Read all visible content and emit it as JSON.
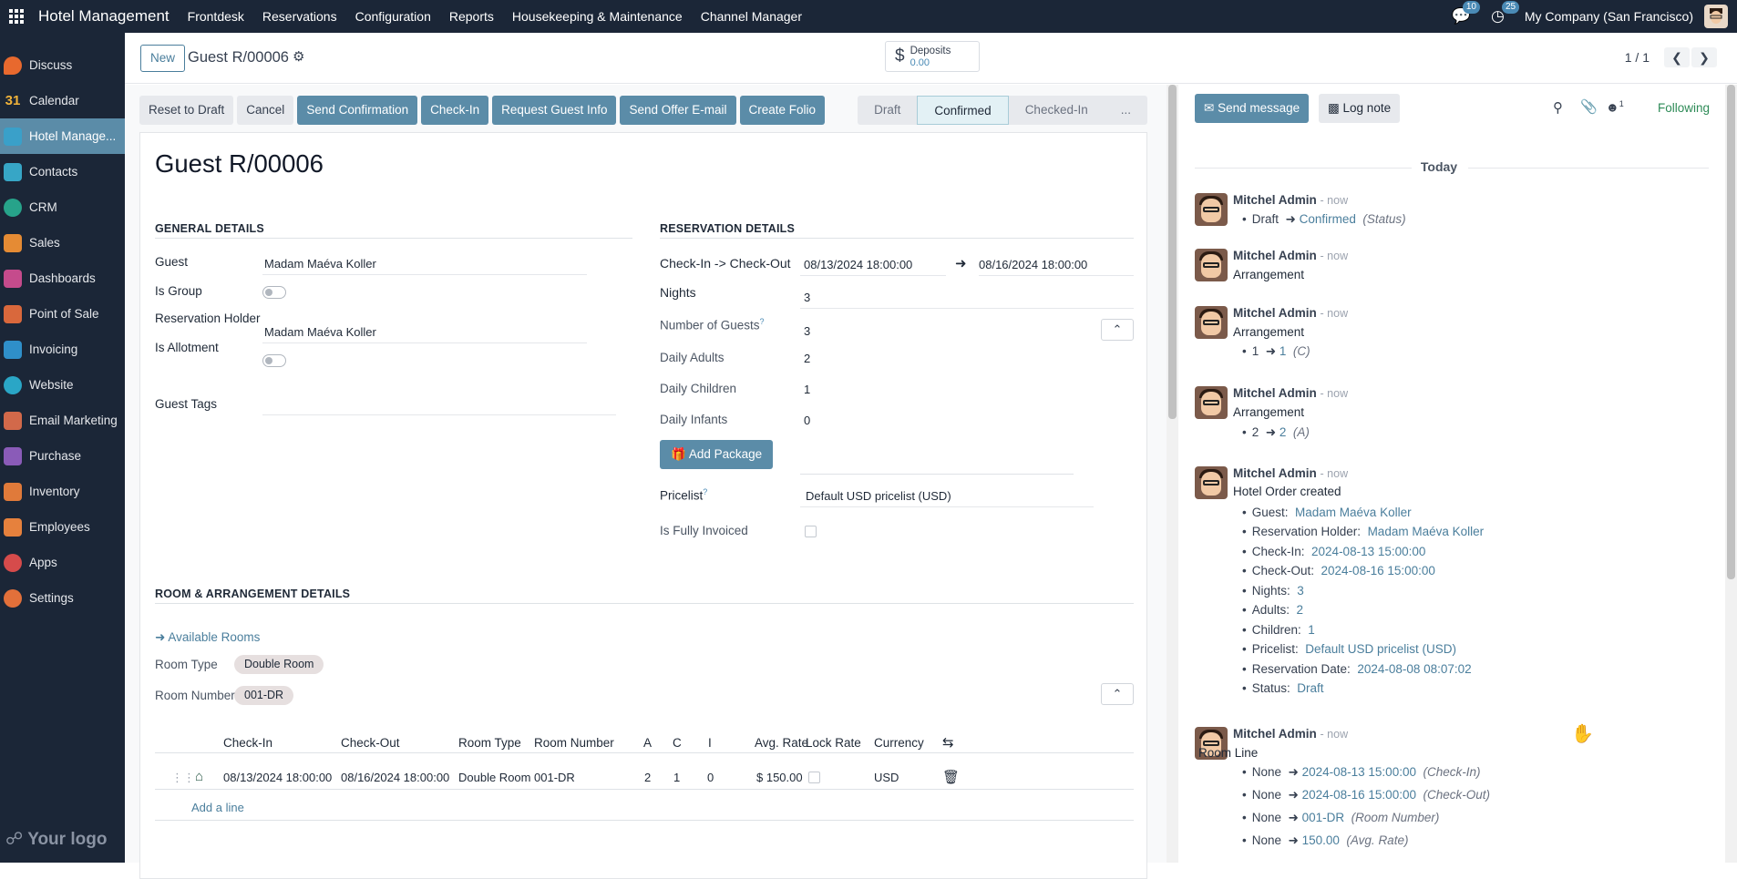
{
  "topbar": {
    "app_name": "Hotel Management",
    "menus": [
      "Frontdesk",
      "Reservations",
      "Configuration",
      "Reports",
      "Housekeeping & Maintenance",
      "Channel Manager"
    ],
    "messages_count": "10",
    "activity_count": "25",
    "company": "My Company (San Francisco)"
  },
  "sidebar": {
    "items": [
      {
        "label": "Discuss",
        "icon": "discuss-icon",
        "color": "#e8692e"
      },
      {
        "label": "Calendar",
        "icon": "calendar-icon",
        "color": "#f1b33a",
        "glyph": "31"
      },
      {
        "label": "Hotel Manage...",
        "icon": "hotel-icon",
        "color": "#3aa0c9",
        "active": true
      },
      {
        "label": "Contacts",
        "icon": "contacts-icon",
        "color": "#37a6c6"
      },
      {
        "label": "CRM",
        "icon": "crm-icon",
        "color": "#27a38a"
      },
      {
        "label": "Sales",
        "icon": "sales-icon",
        "color": "#e58b34"
      },
      {
        "label": "Dashboards",
        "icon": "dashboards-icon",
        "color": "#c54b8c"
      },
      {
        "label": "Point of Sale",
        "icon": "pos-icon",
        "color": "#d9683c"
      },
      {
        "label": "Invoicing",
        "icon": "invoicing-icon",
        "color": "#2f8fc9"
      },
      {
        "label": "Website",
        "icon": "website-icon",
        "color": "#2aa6c6"
      },
      {
        "label": "Email Marketing",
        "icon": "email-marketing-icon",
        "color": "#d2694a"
      },
      {
        "label": "Purchase",
        "icon": "purchase-icon",
        "color": "#8a5bb8"
      },
      {
        "label": "Inventory",
        "icon": "inventory-icon",
        "color": "#e07a3a"
      },
      {
        "label": "Employees",
        "icon": "employees-icon",
        "color": "#e6813d"
      },
      {
        "label": "Apps",
        "icon": "apps-icon",
        "color": "#d64b4b"
      },
      {
        "label": "Settings",
        "icon": "settings-icon",
        "color": "#e2703a"
      }
    ],
    "logo": "Your logo"
  },
  "control": {
    "new_label": "New",
    "breadcrumb": "Guest R/00006",
    "deposits_label": "Deposits",
    "deposits_value": "0.00",
    "pager": "1 / 1"
  },
  "actions": {
    "buttons": [
      "Reset to Draft",
      "Cancel",
      "Send Confirmation",
      "Check-In",
      "Request Guest Info",
      "Send Offer E-mail",
      "Create Folio"
    ],
    "stages": [
      "Draft",
      "Confirmed",
      "Checked-In",
      "..."
    ],
    "active_stage": "Confirmed"
  },
  "form": {
    "title": "Guest R/00006",
    "general": {
      "heading": "GENERAL DETAILS",
      "guest_label": "Guest",
      "guest_value": "Madam Maéva Koller",
      "is_group_label": "Is Group",
      "holder_label": "Reservation Holder",
      "holder_value": "Madam Maéva Koller",
      "allotment_label": "Is Allotment",
      "tags_label": "Guest Tags"
    },
    "reservation": {
      "heading": "RESERVATION DETAILS",
      "checkin_label": "Check-In -> Check-Out",
      "checkin_value": "08/13/2024 18:00:00",
      "checkout_value": "08/16/2024 18:00:00",
      "nights_label": "Nights",
      "nights_value": "3",
      "guests_label": "Number of Guests",
      "guests_value": "3",
      "adults_label": "Daily Adults",
      "adults_value": "2",
      "children_label": "Daily Children",
      "children_value": "1",
      "infants_label": "Daily Infants",
      "infants_value": "0",
      "package_label": "Add Package",
      "pricelist_label": "Pricelist",
      "pricelist_value": "Default USD pricelist (USD)",
      "invoiced_label": "Is Fully Invoiced",
      "help_mark": "?"
    },
    "rooms": {
      "heading": "ROOM & ARRANGEMENT DETAILS",
      "available_link": "Available Rooms",
      "room_type_label": "Room Type",
      "room_type_value": "Double Room",
      "room_number_label": "Room Number",
      "room_number_value": "001-DR",
      "columns": [
        "Check-In",
        "Check-Out",
        "Room Type",
        "Room Number",
        "A",
        "C",
        "I",
        "Avg. Rate",
        "Lock Rate",
        "Currency"
      ],
      "row": {
        "checkin": "08/13/2024 18:00:00",
        "checkout": "08/16/2024 18:00:00",
        "room_type": "Double Room",
        "room_number": "001-DR",
        "a": "2",
        "c": "1",
        "i": "0",
        "rate": "$ 150.00",
        "currency": "USD"
      },
      "add_line": "Add a line"
    }
  },
  "chatter": {
    "send_message": "Send message",
    "log_note": "Log note",
    "followers_count": "1",
    "following": "Following",
    "today": "Today",
    "messages": [
      {
        "author": "Mitchel Admin",
        "time": "- now",
        "body": "",
        "changes": [
          {
            "old": "Draft",
            "new": "Confirmed",
            "field": "(Status)"
          }
        ]
      },
      {
        "author": "Mitchel Admin",
        "time": "- now",
        "body": "Arrangement",
        "changes": []
      },
      {
        "author": "Mitchel Admin",
        "time": "- now",
        "body": "Arrangement",
        "changes": [
          {
            "old": "1",
            "new": "1",
            "field": "(C)"
          }
        ]
      },
      {
        "author": "Mitchel Admin",
        "time": "- now",
        "body": "Arrangement",
        "changes": [
          {
            "old": "2",
            "new": "2",
            "field": "(A)"
          }
        ]
      },
      {
        "author": "Mitchel Admin",
        "time": "- now",
        "body": "Hotel Order created",
        "fields": [
          {
            "k": "Guest:",
            "v": "Madam Maéva Koller"
          },
          {
            "k": "Reservation Holder:",
            "v": "Madam Maéva Koller"
          },
          {
            "k": "Check-In:",
            "v": "2024-08-13 15:00:00"
          },
          {
            "k": "Check-Out:",
            "v": "2024-08-16 15:00:00"
          },
          {
            "k": "Nights:",
            "v": "3"
          },
          {
            "k": "Adults:",
            "v": "2"
          },
          {
            "k": "Children:",
            "v": "1"
          },
          {
            "k": "Pricelist:",
            "v": "Default USD pricelist (USD)"
          },
          {
            "k": "Reservation Date:",
            "v": "2024-08-08 08:07:02"
          },
          {
            "k": "Status:",
            "v": "Draft"
          }
        ]
      },
      {
        "author": "Mitchel Admin",
        "time": "- now",
        "body": "Room Line",
        "changes": [
          {
            "old": "None",
            "new": "2024-08-13 15:00:00",
            "field": "(Check-In)"
          },
          {
            "old": "None",
            "new": "2024-08-16 15:00:00",
            "field": "(Check-Out)"
          },
          {
            "old": "None",
            "new": "001-DR",
            "field": "(Room Number)"
          },
          {
            "old": "None",
            "new": "150.00",
            "field": "(Avg. Rate)"
          }
        ]
      }
    ]
  }
}
